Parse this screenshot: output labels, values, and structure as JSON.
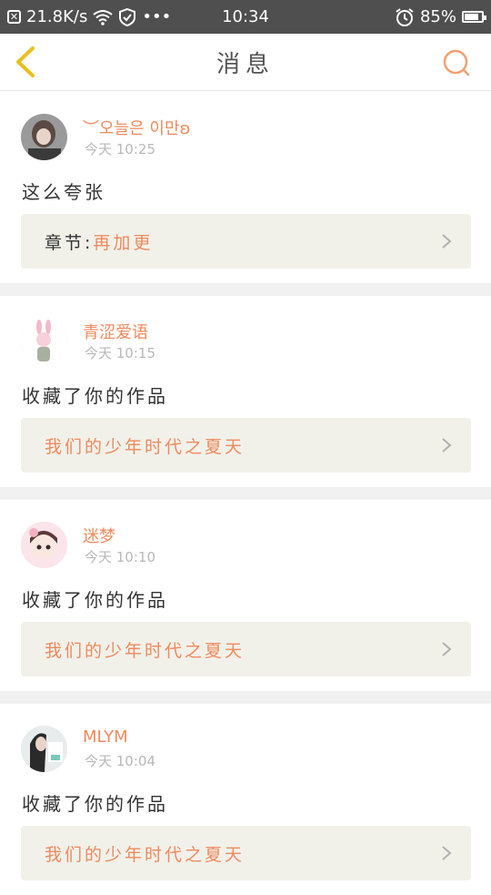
{
  "status_bar": {
    "speed": "21.8K/s",
    "more": "•••",
    "time": "10:34",
    "battery": "85%",
    "battery_level": 0.85
  },
  "header": {
    "title": "消息",
    "accent_color": "#f0a070",
    "back_icon_color": "#e8c020"
  },
  "messages": [
    {
      "user": "︶오늘은 이만ʚ",
      "time": "今天 10:25",
      "text": "这么夸张",
      "ref_prefix": "章节:",
      "ref_title": "再加更"
    },
    {
      "user": "青涩爱语",
      "time": "今天 10:15",
      "text": "收藏了你的作品",
      "ref_prefix": "",
      "ref_title": "我们的少年时代之夏天"
    },
    {
      "user": "迷梦",
      "time": "今天 10:10",
      "text": "收藏了你的作品",
      "ref_prefix": "",
      "ref_title": "我们的少年时代之夏天"
    },
    {
      "user": "MLYM",
      "time": "今天 10:04",
      "text": "收藏了你的作品",
      "ref_prefix": "",
      "ref_title": "我们的少年时代之夏天"
    }
  ]
}
